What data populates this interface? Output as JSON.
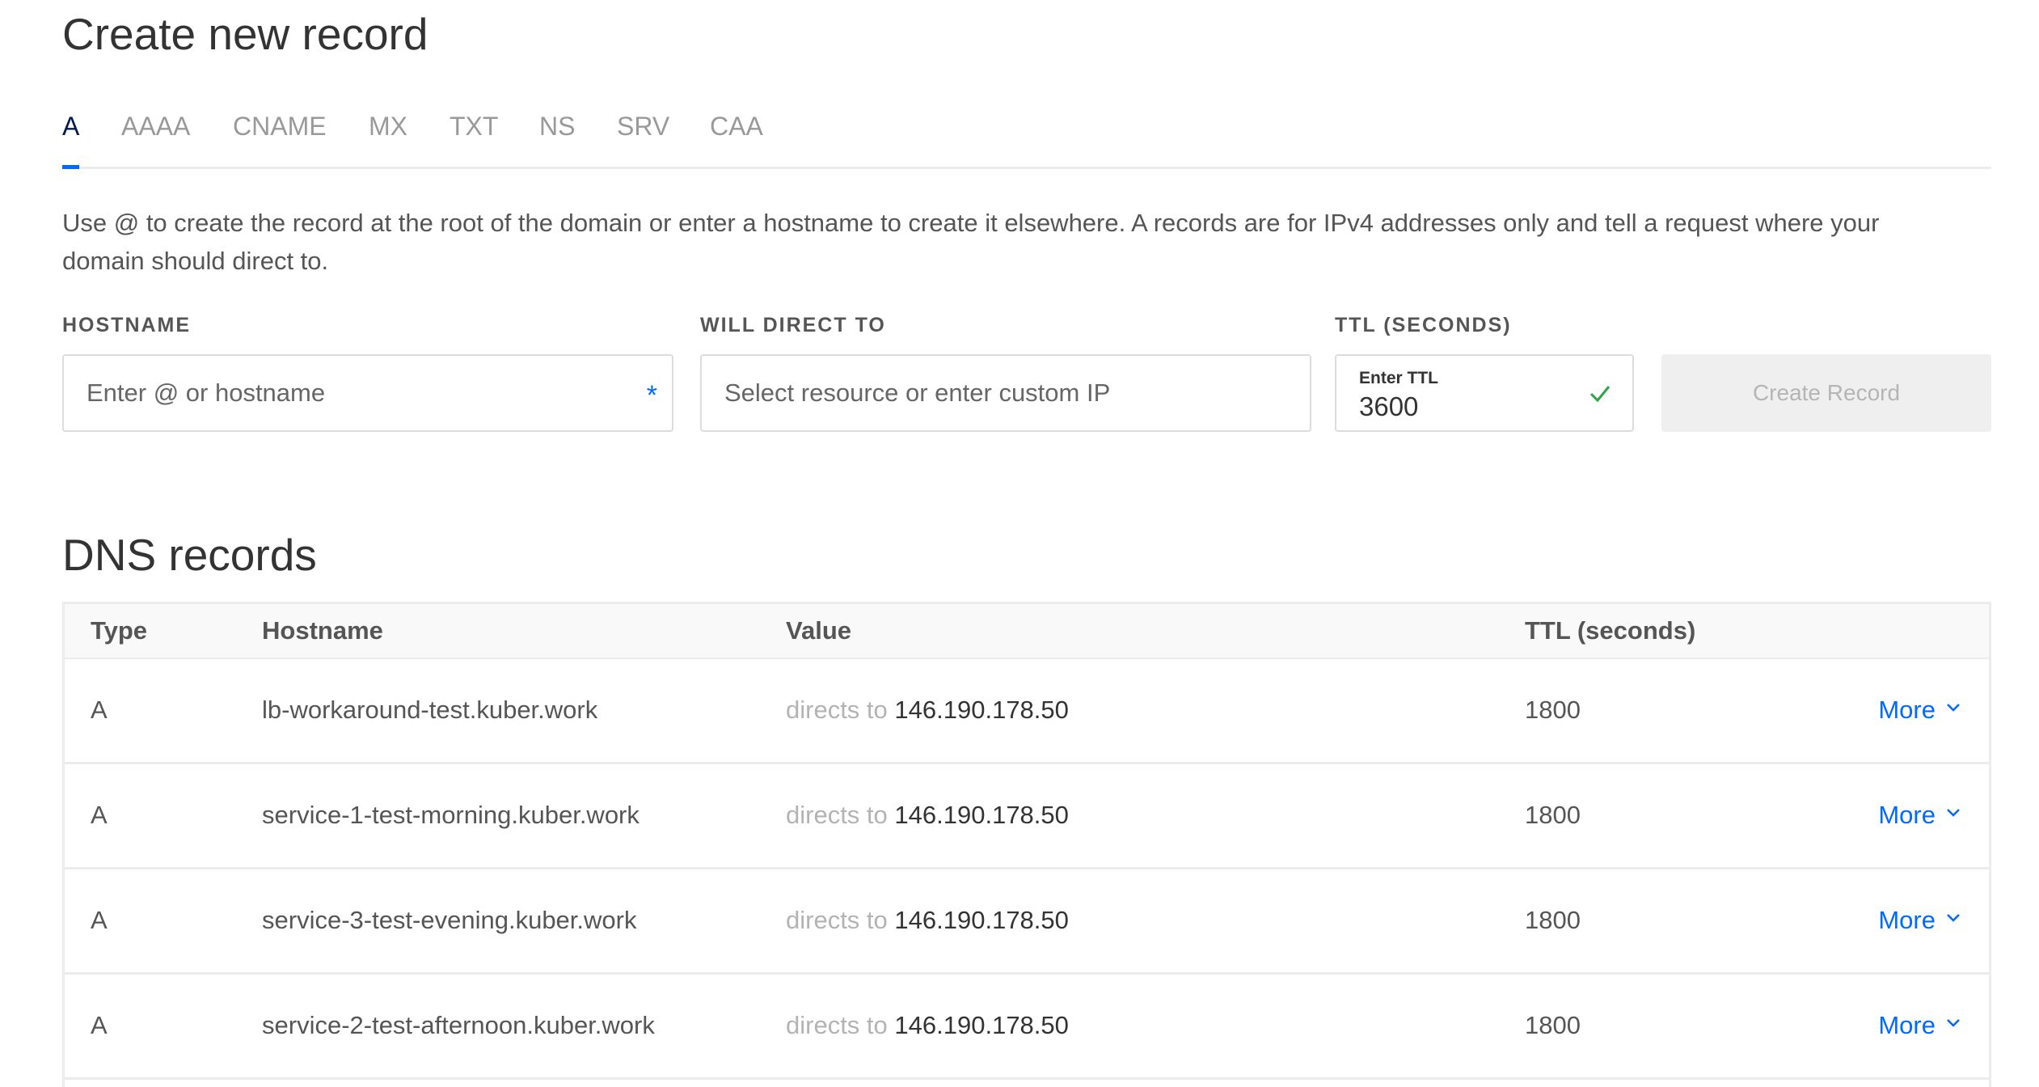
{
  "create": {
    "title": "Create new record",
    "tabs": [
      {
        "label": "A",
        "active": true
      },
      {
        "label": "AAAA",
        "active": false
      },
      {
        "label": "CNAME",
        "active": false
      },
      {
        "label": "MX",
        "active": false
      },
      {
        "label": "TXT",
        "active": false
      },
      {
        "label": "NS",
        "active": false
      },
      {
        "label": "SRV",
        "active": false
      },
      {
        "label": "CAA",
        "active": false
      }
    ],
    "help_line1": "Use @ to create the record at the root of the domain or enter a hostname to create it elsewhere. A records are for IPv4 addresses only and tell a request where your",
    "help_line2": "domain should direct to.",
    "hostname": {
      "label": "HOSTNAME",
      "placeholder": "Enter @ or hostname",
      "required_mark": "*"
    },
    "direct": {
      "label": "WILL DIRECT TO",
      "placeholder": "Select resource or enter custom IP"
    },
    "ttl": {
      "label": "TTL (SECONDS)",
      "mini_label": "Enter TTL",
      "value": "3600"
    },
    "button": "Create Record"
  },
  "dns": {
    "title": "DNS records",
    "headers": {
      "type": "Type",
      "hostname": "Hostname",
      "value": "Value",
      "ttl": "TTL (seconds)"
    },
    "directs_prefix": "directs to",
    "more_label": "More",
    "rows": [
      {
        "type": "A",
        "hostname": "lb-workaround-test.kuber.work",
        "value": "146.190.178.50",
        "ttl": "1800"
      },
      {
        "type": "A",
        "hostname": "service-1-test-morning.kuber.work",
        "value": "146.190.178.50",
        "ttl": "1800"
      },
      {
        "type": "A",
        "hostname": "service-3-test-evening.kuber.work",
        "value": "146.190.178.50",
        "ttl": "1800"
      },
      {
        "type": "A",
        "hostname": "service-2-test-afternoon.kuber.work",
        "value": "146.190.178.50",
        "ttl": "1800"
      }
    ]
  },
  "colors": {
    "accent": "#0069ff",
    "active_tab": "#031b4e",
    "success": "#28a745"
  }
}
